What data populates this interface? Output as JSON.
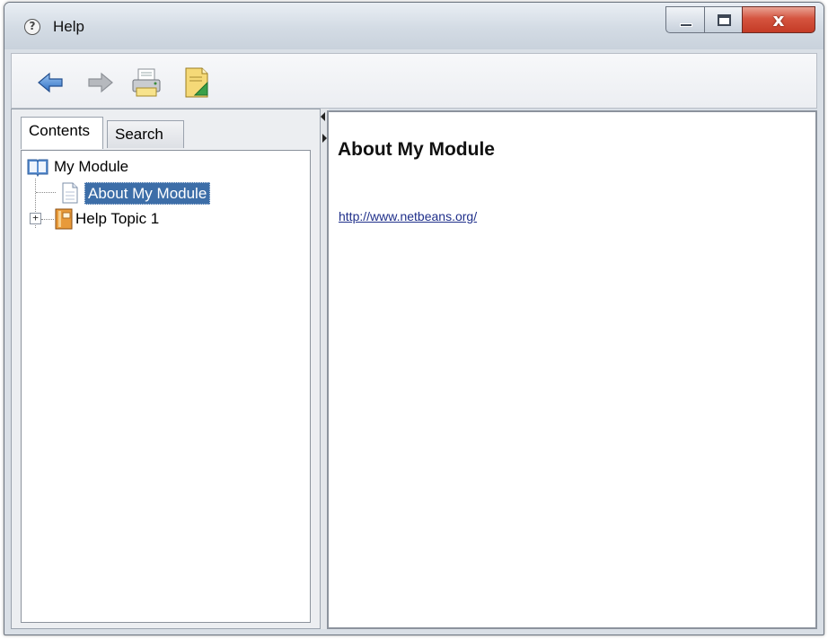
{
  "window": {
    "title": "Help",
    "title_icon_glyph": "?",
    "controls": {
      "minimize_icon": "minimize-icon",
      "maximize_icon": "maximize-icon",
      "close_glyph": "x"
    }
  },
  "toolbar": {
    "buttons": [
      {
        "name": "back",
        "icon": "back-arrow-icon"
      },
      {
        "name": "forward",
        "icon": "forward-arrow-icon"
      },
      {
        "name": "print",
        "icon": "printer-icon"
      },
      {
        "name": "page-setup",
        "icon": "page-setup-icon"
      }
    ]
  },
  "navigator": {
    "tabs": [
      {
        "label": "Contents",
        "active": true
      },
      {
        "label": "Search",
        "active": false
      }
    ],
    "tree": {
      "root": {
        "label": "My Module",
        "icon": "book-icon"
      },
      "items": [
        {
          "label": "About My Module",
          "icon": "page-icon",
          "selected": true
        },
        {
          "label": "Help Topic 1",
          "icon": "topic-icon",
          "expandable": true,
          "expander": "+"
        }
      ]
    }
  },
  "content": {
    "heading": "About My Module",
    "link": "http://www.netbeans.org/"
  },
  "colors": {
    "selection": "#3d6ea8",
    "link": "#1f2f8a",
    "close_button": "#c43b26"
  }
}
